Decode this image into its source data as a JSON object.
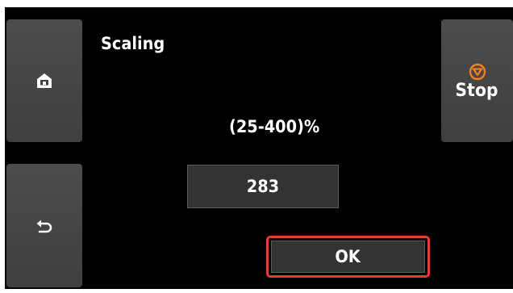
{
  "screen": {
    "title": "Scaling",
    "range_label": "(25-400)%"
  },
  "value_field": {
    "value": "283"
  },
  "buttons": {
    "ok_label": "OK",
    "stop_label": "Stop"
  },
  "icons": {
    "home": "home-icon",
    "back": "back-arrow-icon",
    "stop": "stop-icon"
  },
  "colors": {
    "stop_accent": "#f08020",
    "focus_outline": "#e2402a"
  }
}
